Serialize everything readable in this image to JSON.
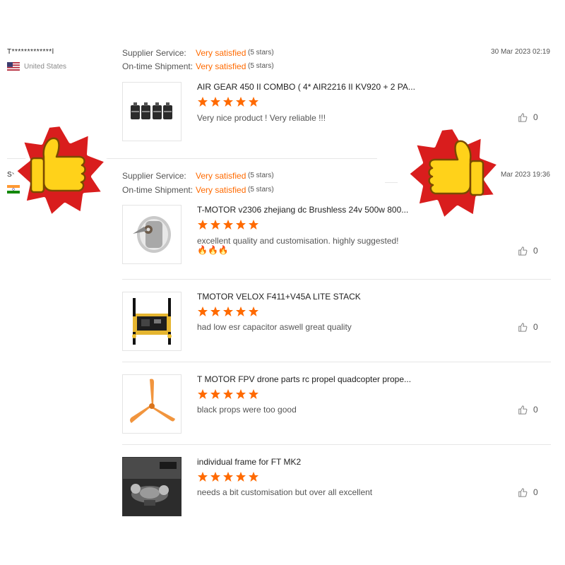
{
  "reviewers": [
    {
      "name": "T*************l",
      "country": "United States",
      "flag": "us"
    },
    {
      "name": "S*",
      "country": "",
      "flag": "in"
    }
  ],
  "ratings": [
    {
      "supplier_label": "Supplier Service:",
      "supplier_value": "Very satisfied",
      "supplier_stars": "(5 stars)",
      "shipment_label": "On-time Shipment:",
      "shipment_value": "Very satisfied",
      "shipment_stars": "(5 stars)"
    },
    {
      "supplier_label": "Supplier Service:",
      "supplier_value": "Very satisfied",
      "supplier_stars": "(5 stars)",
      "shipment_label": "On-time Shipment:",
      "shipment_value": "Very satisfied",
      "shipment_stars": "(5 stars)"
    }
  ],
  "dates": [
    "30 Mar 2023 02:19",
    "Mar 2023 19:36"
  ],
  "reviews": [
    {
      "title": "AIR GEAR 450 II COMBO ( 4* AIR2216 II KV920 + 2 PA...",
      "stars": 5,
      "text": "Very nice product ! Very reliable !!!",
      "likes": "0",
      "image": "motors"
    },
    {
      "title": "T-MOTOR v2306 zhejiang dc Brushless 24v 500w 800...",
      "stars": 5,
      "text": "excellent quality and customisation. highly suggested!",
      "text2": "🔥🔥🔥",
      "likes": "0",
      "image": "motor"
    },
    {
      "title": "TMOTOR VELOX F411+V45A LITE STACK",
      "stars": 5,
      "text": "had low esr capacitor aswell great quality",
      "likes": "0",
      "image": "stack"
    },
    {
      "title": "T MOTOR FPV drone parts rc propel quadcopter prope...",
      "stars": 5,
      "text": "black props were too good",
      "likes": "0",
      "image": "propeller"
    },
    {
      "title": "individual frame for FT MK2",
      "stars": 5,
      "text": "needs a bit customisation but over all excellent",
      "likes": "0",
      "image": "frame"
    }
  ],
  "colors": {
    "accent": "#ff6a00",
    "star": "#ff6a00",
    "sticker_red": "#d91d1d",
    "thumb_yellow": "#ffd21a"
  },
  "icons": {
    "like": "thumbs-up-icon",
    "sticker": "thumbs-up-sticker"
  }
}
